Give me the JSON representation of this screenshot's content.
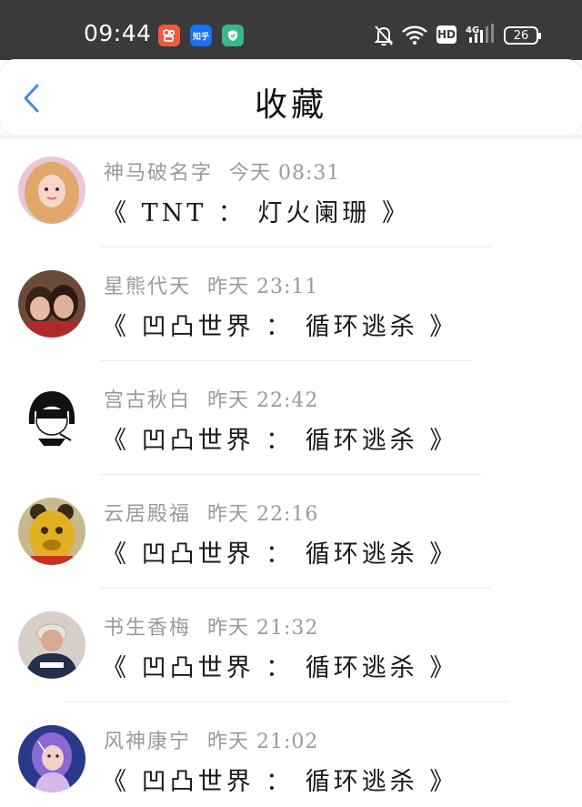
{
  "status_bar": {
    "time": "09:44",
    "apps": [
      {
        "icon": "kuaishou-icon",
        "text": ""
      },
      {
        "icon": "zhihu-icon",
        "text": "知乎"
      },
      {
        "icon": "shield-icon",
        "text": ""
      }
    ],
    "network": "4G",
    "battery": "26"
  },
  "header": {
    "title": "收藏",
    "back_icon": "chevron-left-icon"
  },
  "colors": {
    "status_bg": "#3a3a3a",
    "accent": "#3b8df2",
    "meta_text": "#9a9a9a"
  },
  "favorites": [
    {
      "user": "神马破名字",
      "time": "今天 08:31",
      "title": "《 TNT ： 灯火阑珊 》"
    },
    {
      "user": "星熊代天",
      "time": "昨天 23:11",
      "title": "《 凹凸世界 ： 循环逃杀 》"
    },
    {
      "user": "宫古秋白",
      "time": "昨天 22:42",
      "title": "《 凹凸世界 ： 循环逃杀 》"
    },
    {
      "user": "云居殿福",
      "time": "昨天 22:16",
      "title": "《 凹凸世界 ： 循环逃杀 》"
    },
    {
      "user": "书生香梅",
      "time": "昨天 21:32",
      "title": "《 凹凸世界 ： 循环逃杀 》"
    },
    {
      "user": "风神康宁",
      "time": "昨天 21:02",
      "title": "《 凹凸世界 ： 循环逃杀 》"
    }
  ]
}
